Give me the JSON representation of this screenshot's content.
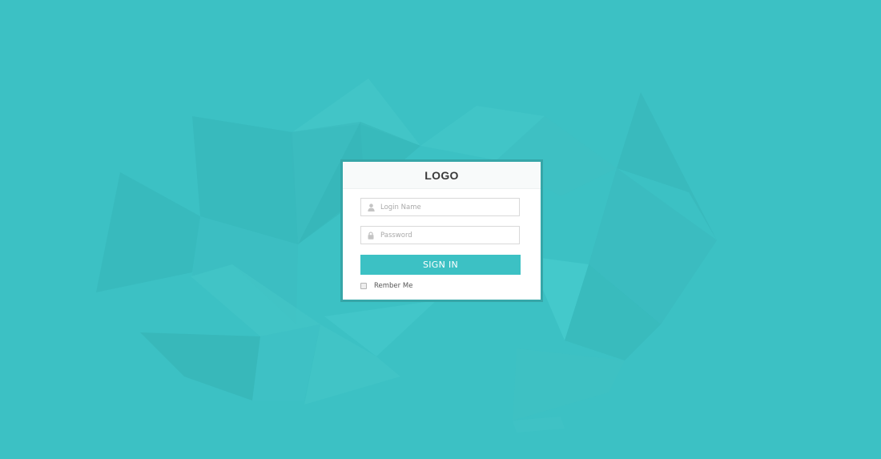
{
  "colors": {
    "background": "#3cc1c4",
    "accent": "#3cc1c4",
    "card_border": "#36a6a8"
  },
  "login": {
    "logo": "LOGO",
    "username": {
      "placeholder": "Login Name",
      "value": "",
      "icon": "user-icon"
    },
    "password": {
      "placeholder": "Password",
      "value": "",
      "icon": "lock-icon"
    },
    "submit_label": "SIGN IN",
    "remember_label": "Rember Me",
    "remember_checked": false
  }
}
